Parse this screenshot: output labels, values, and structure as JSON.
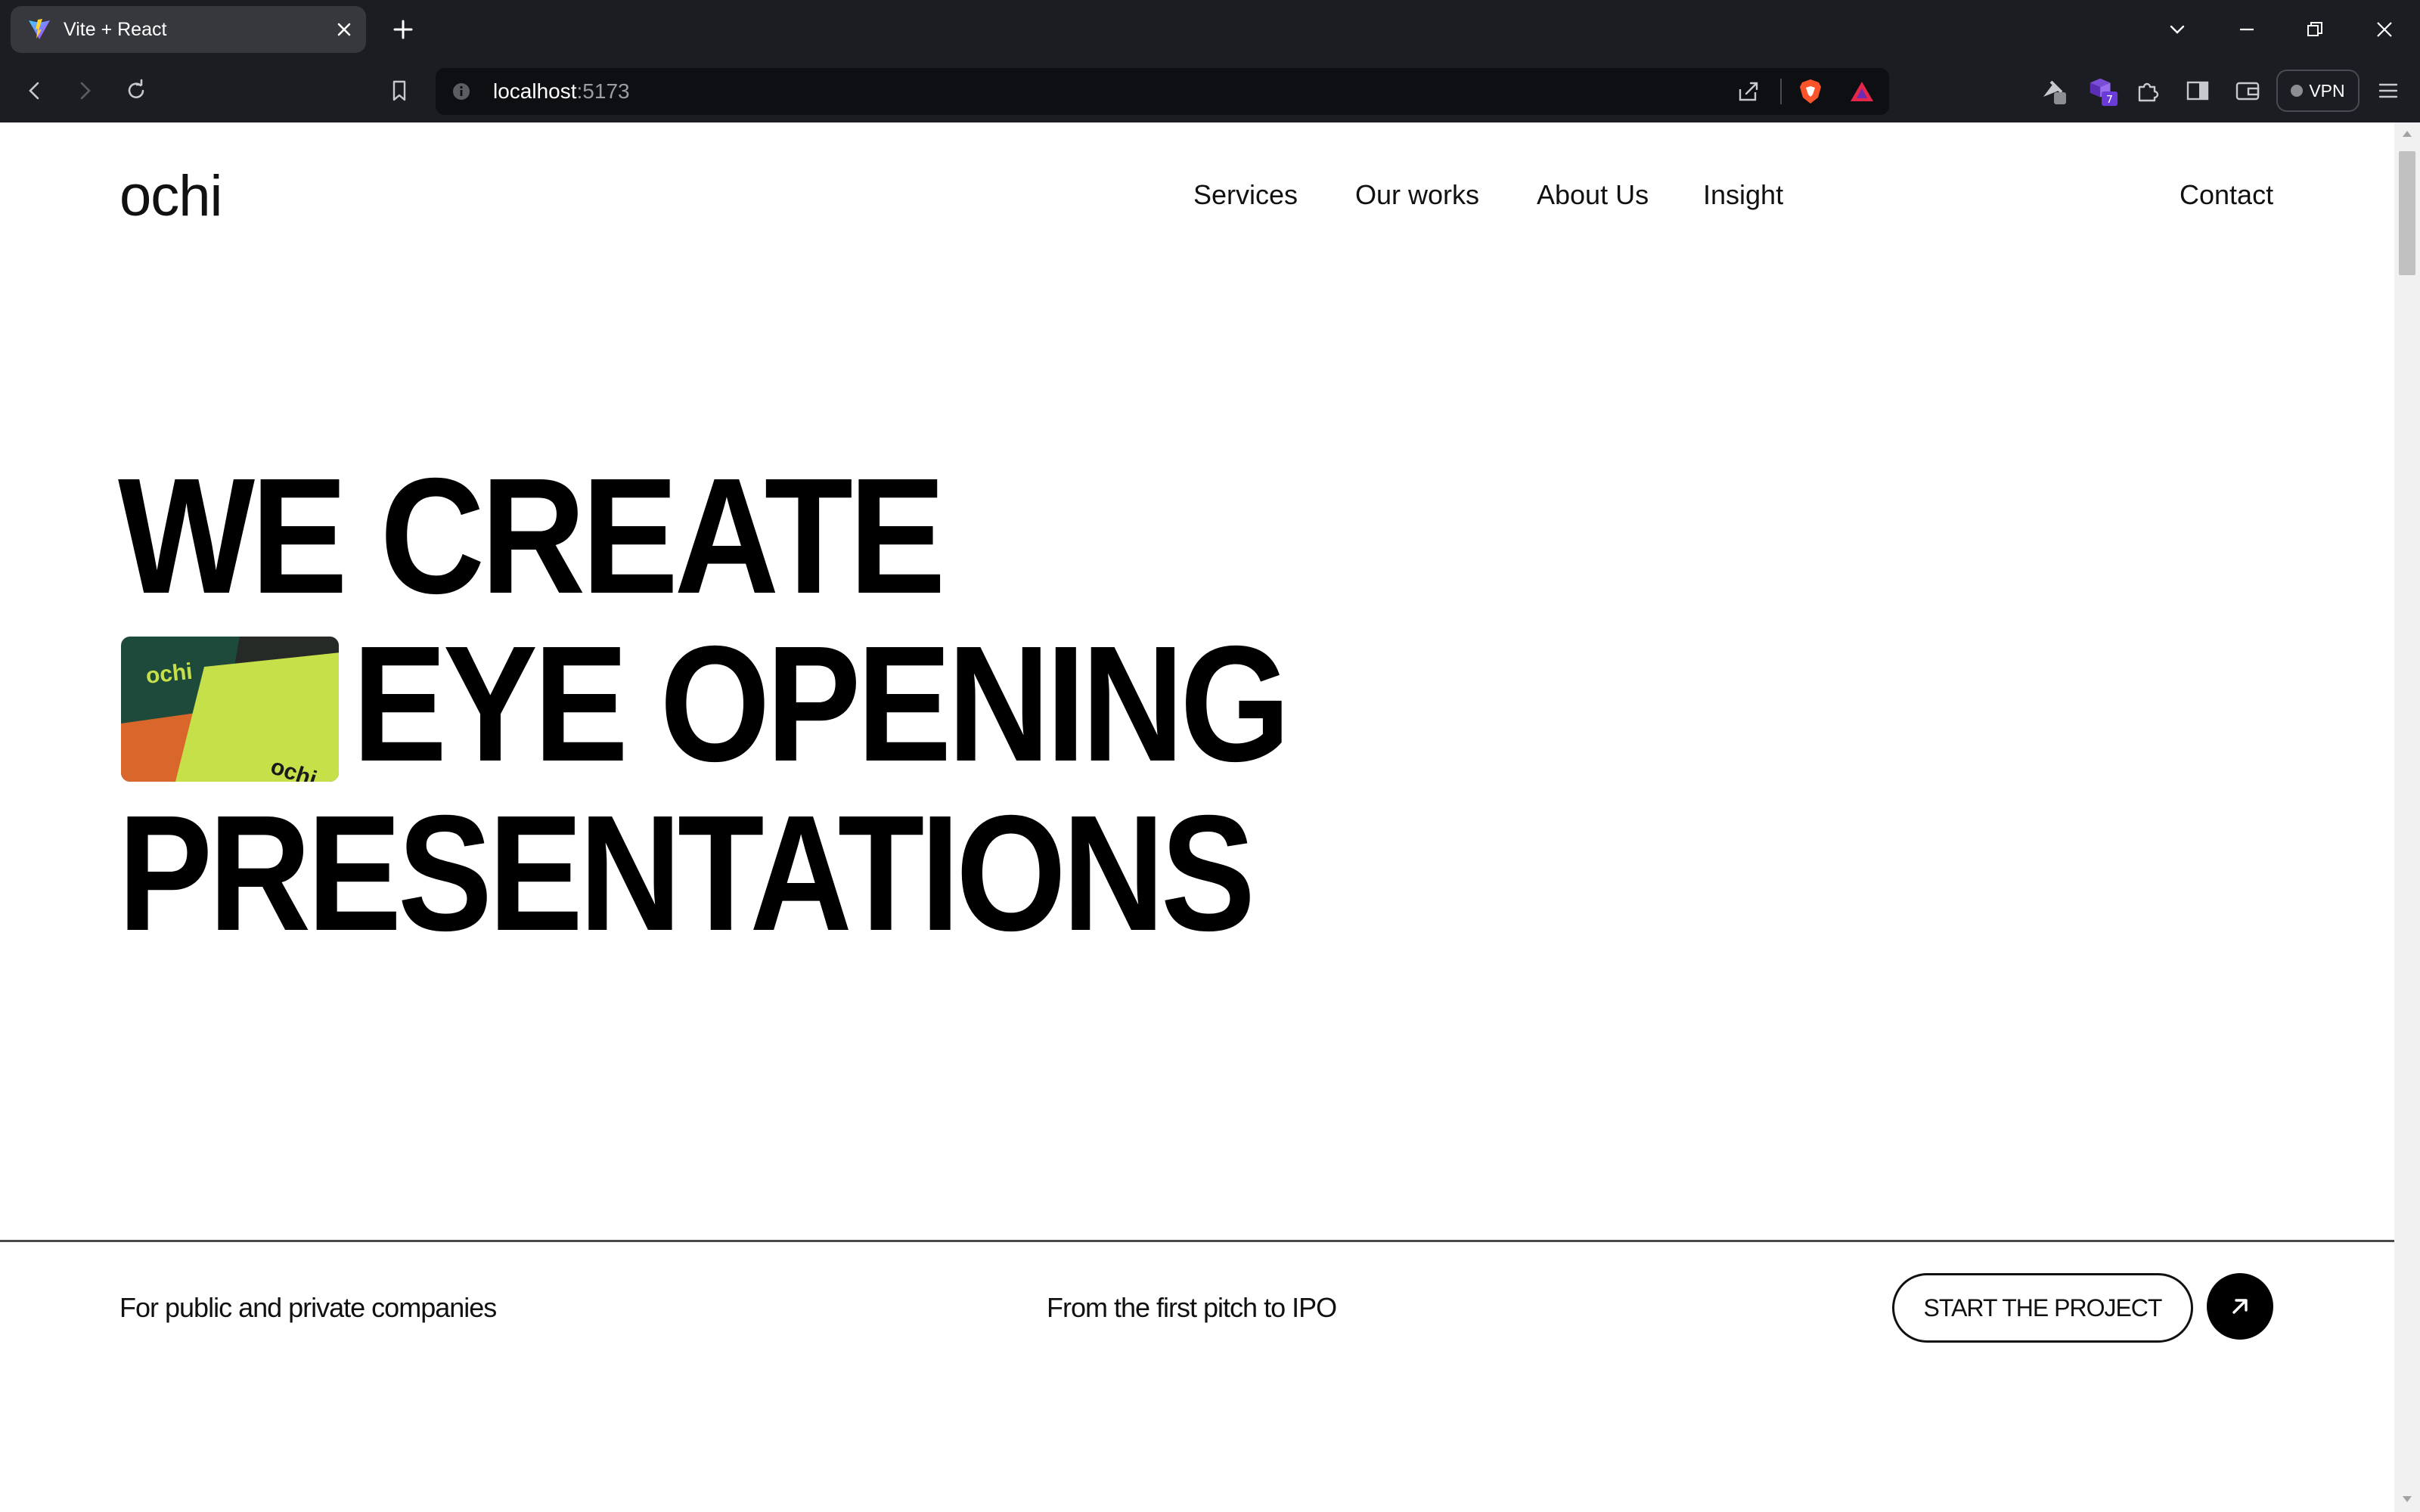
{
  "browser": {
    "tab_title": "Vite + React",
    "url_host": "localhost",
    "url_port": ":5173",
    "vpn_label": "VPN",
    "extension_badge": "7"
  },
  "site": {
    "logo": "ochi",
    "nav": [
      "Services",
      "Our works",
      "About Us",
      "Insight"
    ],
    "contact": "Contact"
  },
  "hero": {
    "lines": [
      "WE CREATE",
      "EYE OPENING",
      "PRESENTATIONS"
    ],
    "image_text_top": "ochi",
    "image_text_bottom": "ochi",
    "image_colors": {
      "dark": "#1d4a3a",
      "lime": "#c6e04a",
      "orange": "#d9672c"
    }
  },
  "bottom": {
    "left": "For public and private companies",
    "center": "From the first pitch to IPO",
    "cta": "START THE PROJECT",
    "cta_icon": "arrow-up-right-icon"
  },
  "colors": {
    "chrome_bg": "#1c1d22",
    "page_bg": "#ffffff",
    "text": "#111111"
  }
}
